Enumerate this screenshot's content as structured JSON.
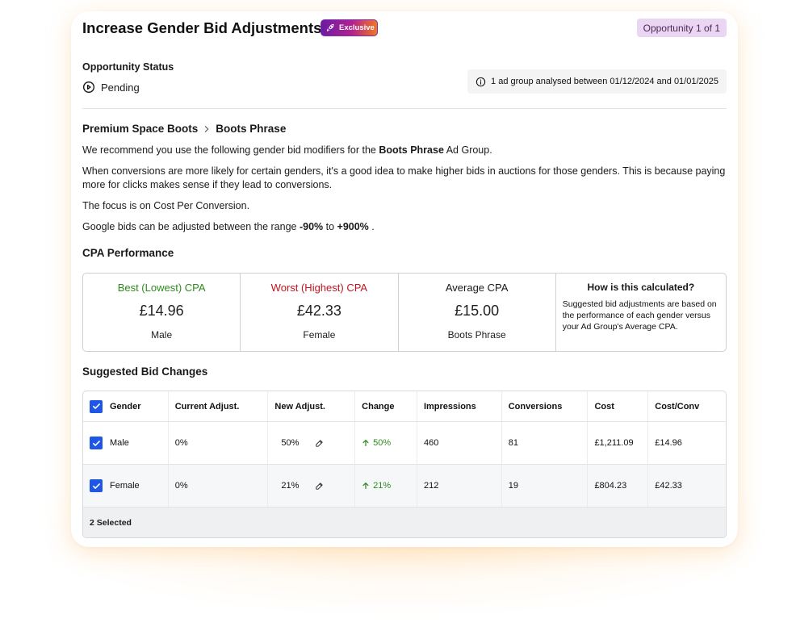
{
  "header": {
    "title": "Increase Gender Bid Adjustments",
    "badge": "Exclusive",
    "opportunity": "Opportunity 1 of 1"
  },
  "status": {
    "label": "Opportunity Status",
    "value": "Pending",
    "info": "1 ad group analysed between 01/12/2024 and 01/01/2025"
  },
  "breadcrumb": {
    "campaign": "Premium Space Boots",
    "ad_group": "Boots Phrase"
  },
  "recommendation": {
    "p1_start": "We recommend you use the following gender bid modifiers for the ",
    "p1_bold": "Boots Phrase",
    "p1_end": " Ad Group.",
    "p2": "When conversions are more likely for certain genders, it's a good idea to make higher bids in auctions for those genders. This is because paying more for clicks makes sense if they lead to conversions.",
    "p3": "The focus is on Cost Per Conversion.",
    "p4_start": "Google bids can be adjusted between the range ",
    "p4_min": "-90%",
    "p4_mid": " to ",
    "p4_max": "+900%",
    "p4_end": " ."
  },
  "cpa": {
    "title": "CPA Performance",
    "best": {
      "label": "Best (Lowest) CPA",
      "value": "£14.96",
      "sub": "Male"
    },
    "worst": {
      "label": "Worst (Highest) CPA",
      "value": "£42.33",
      "sub": "Female"
    },
    "average": {
      "label": "Average CPA",
      "value": "£15.00",
      "sub": "Boots Phrase"
    },
    "how_title": "How is this calculated?",
    "how_text": "Suggested bid adjustments are based on the performance of each gender versus your Ad Group's Average CPA."
  },
  "bids": {
    "title": "Suggested Bid Changes",
    "columns": [
      "Gender",
      "Current Adjust.",
      "New Adjust.",
      "Change",
      "Impressions",
      "Conversions",
      "Cost",
      "Cost/Conv"
    ],
    "rows": [
      {
        "gender": "Male",
        "current": "0%",
        "new": "50%",
        "change": "50%",
        "impressions": "460",
        "conversions": "81",
        "cost": "£1,211.09",
        "cost_conv": "£14.96"
      },
      {
        "gender": "Female",
        "current": "0%",
        "new": "21%",
        "change": "21%",
        "impressions": "212",
        "conversions": "19",
        "cost": "£804.23",
        "cost_conv": "£42.33"
      }
    ],
    "footer": "2 Selected"
  },
  "colors": {
    "accent": "#1e56e6",
    "positive": "#2e8b1e",
    "negative": "#c0141e",
    "badge_bg": "#ead6f3"
  }
}
